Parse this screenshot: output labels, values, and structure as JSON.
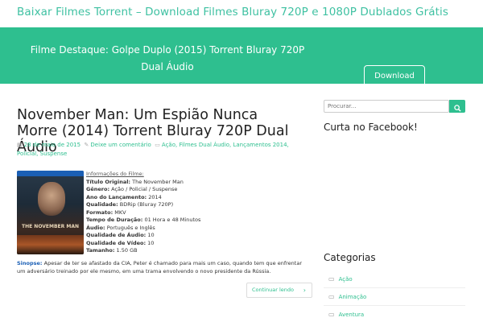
{
  "site": {
    "title": "Baixar Filmes Torrent – Download Filmes Bluray 720P e 1080P Dublados Grátis"
  },
  "hero": {
    "text": "Filme Destaque: Golpe Duplo (2015) Torrent Bluray 720P Dual Áudio",
    "button": "Download",
    "bg_color": "#2ebf8f"
  },
  "post": {
    "title": "November Man: Um Espião Nunca Morre (2014) Torrent Bluray 720P Dual Áudio",
    "date": "28 de maio de 2015",
    "comment": "Deixe um comentário",
    "categories": "Ação, Filmes Dual Áudio, Lançamentos 2014, Policial, Suspense",
    "cover_title": "THE NOVEMBER MAN",
    "info_heading": "Informações do Filme:",
    "info": [
      {
        "label": "Título Original:",
        "value": "The November Man"
      },
      {
        "label": "Gênero:",
        "value": "Ação / Policial / Suspense"
      },
      {
        "label": "Ano do Lançamento:",
        "value": "2014"
      },
      {
        "label": "Qualidade:",
        "value": "BDRip (Bluray 720P)"
      },
      {
        "label": "Formato:",
        "value": "MKV"
      },
      {
        "label": "Tempo de Duração:",
        "value": "01 Hora e 48 Minutos"
      },
      {
        "label": "Áudio:",
        "value": "Português e Inglês"
      },
      {
        "label": "Qualidade de Áudio:",
        "value": "10"
      },
      {
        "label": "Qualidade de Vídeo:",
        "value": "10"
      },
      {
        "label": "Tamanho:",
        "value": "1.50 GB"
      }
    ],
    "sinopse_label": "Sinopse:",
    "sinopse": "Apesar de ter se afastado da CIA, Peter é chamado para mais um caso, quando tem que enfrentar um adversário treinado por ele mesmo, em uma trama envolvendo o novo presidente da Rússia.",
    "read_more": "Continuar lendo"
  },
  "sidebar": {
    "search_placeholder": "Procurar...",
    "facebook_title": "Curta no Facebook!",
    "categories_title": "Categorias",
    "categories": [
      "Ação",
      "Animação",
      "Aventura"
    ]
  },
  "icons": {
    "date": "calendar-icon",
    "comment": "comment-icon",
    "category": "folder-icon",
    "search": "search-icon",
    "read_more": "chevron-right-icon"
  }
}
